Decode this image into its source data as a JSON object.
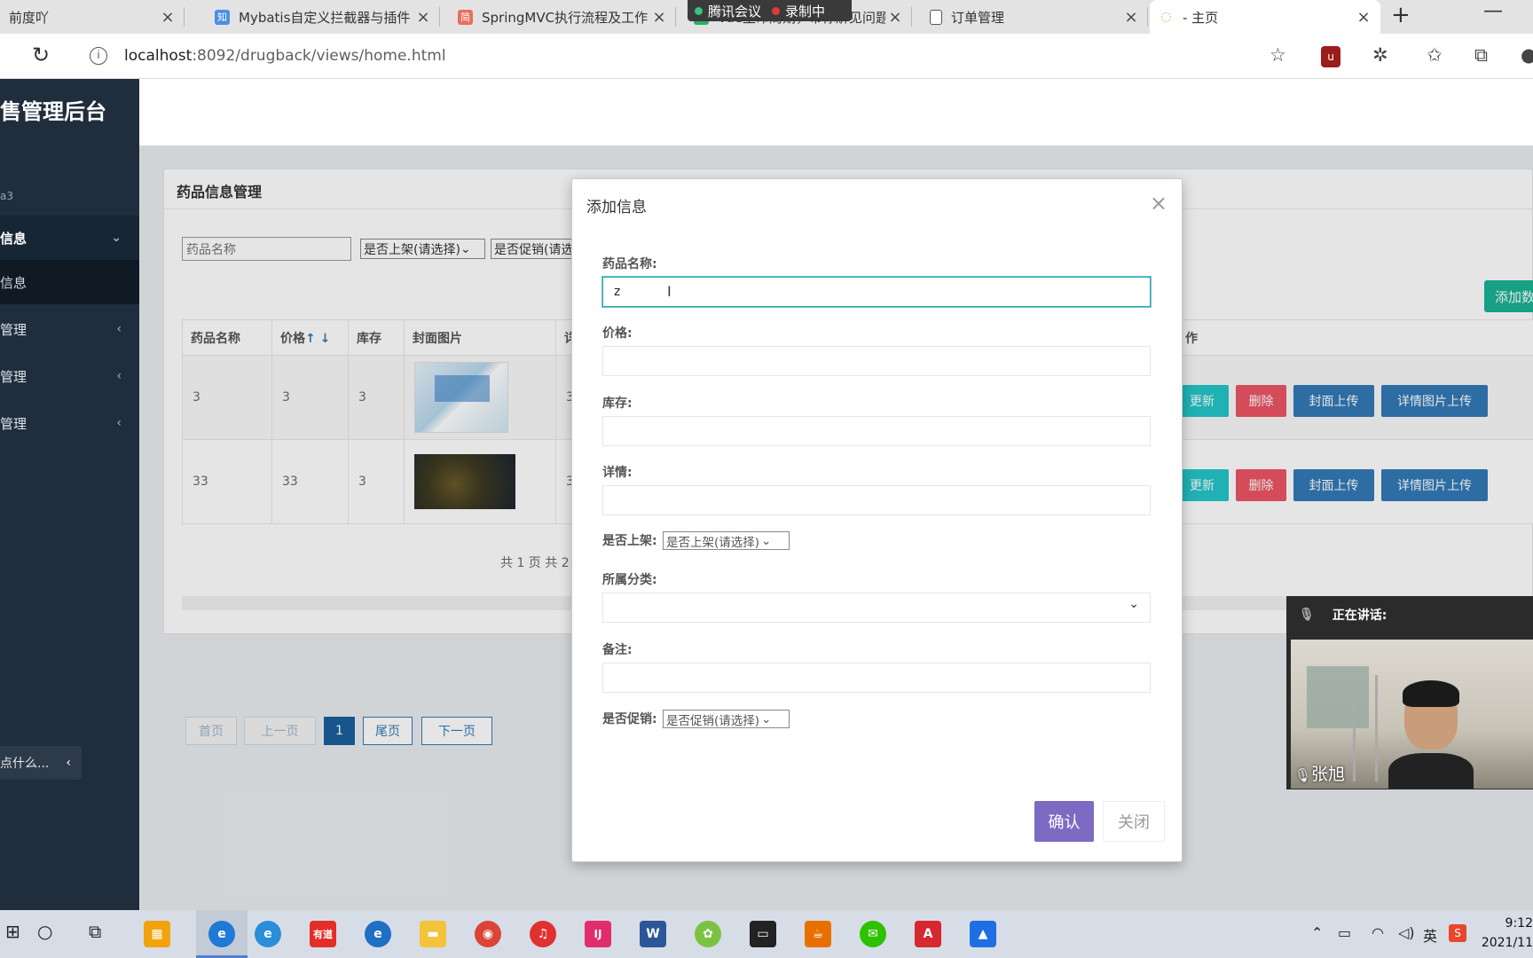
{
  "browser": {
    "tabs": [
      {
        "title": "前度吖",
        "icon": "avatar-icon",
        "color": "#999999"
      },
      {
        "title": "Mybatis自定义拦截器与插件",
        "icon": "zhihu-icon",
        "color": "#4a90e2"
      },
      {
        "title": "SpringMVC执行流程及工作",
        "icon": "jianshu-icon",
        "color": "#ea6f5a"
      },
      {
        "title": "Vue生命周期，带你解见问题",
        "icon": "wechat-icon",
        "color": "#2aae67"
      },
      {
        "title": "订单管理",
        "icon": "document-icon",
        "color": "#555555"
      },
      {
        "title": "- 主页",
        "icon": "loading-icon",
        "color": "#f2a64a"
      }
    ],
    "meeting_bar": {
      "app": "腾讯会议",
      "status": "录制中"
    },
    "url_host": "localhost",
    "url_rest": ":8092/drugback/views/home.html"
  },
  "app": {
    "brand": "售管理后台",
    "user_label": "a3",
    "menu": [
      {
        "label": "信息",
        "open": true
      },
      {
        "label": "管理",
        "open": false
      },
      {
        "label": "管理",
        "open": false
      },
      {
        "label": "管理",
        "open": false
      }
    ],
    "submenu": "信息",
    "chat_stub": "点什么..."
  },
  "panel": {
    "title": "药品信息管理",
    "search_placeholder": "药品名称",
    "filter_shelf": "是否上架(请选择)",
    "filter_promo": "是否促销(请选",
    "add_button": "添加数",
    "columns": [
      "药品名称",
      "价格",
      "库存",
      "封面图片",
      "详",
      "作"
    ],
    "sort_arrows": "↑ ↓",
    "rows": [
      {
        "name": "3",
        "price": "3",
        "stock": "3",
        "detail": "3"
      },
      {
        "name": "33",
        "price": "33",
        "stock": "3",
        "detail": "3"
      }
    ],
    "row_actions": {
      "update": "更新",
      "delete": "删除",
      "cover": "封面上传",
      "detail_img": "详情图片上传"
    },
    "pagination": {
      "first": "首页",
      "prev": "上一页",
      "current": "1",
      "last": "尾页",
      "next": "下一页",
      "total": "共 1 页 共 2"
    }
  },
  "modal": {
    "title": "添加信息",
    "close": "×",
    "fields": {
      "name_label": "药品名称:",
      "name_value": "z",
      "price_label": "价格:",
      "stock_label": "库存:",
      "detail_label": "详情:",
      "shelf_label": "是否上架:",
      "shelf_value": "是否上架(请选择)",
      "category_label": "所属分类:",
      "category_value": "",
      "remark_label": "备注:",
      "promo_label": "是否促销:",
      "promo_value": "是否促销(请选择)"
    },
    "confirm": "确认",
    "close_btn": "关闭"
  },
  "meeting_video": {
    "speaking_label": "正在讲话:",
    "speaker": "张旭"
  },
  "taskbar": {
    "apps": [
      {
        "name": "store-icon",
        "color": "#f0a30a"
      },
      {
        "name": "edge-icon",
        "color": "#1e7ad6"
      },
      {
        "name": "ie-icon",
        "color": "#2a8ed8"
      },
      {
        "name": "youdao-icon",
        "color": "#e52d27",
        "label": "有道"
      },
      {
        "name": "edge-beta-icon",
        "color": "#1f6fc4"
      },
      {
        "name": "file-explorer-icon",
        "color": "#f3c33b"
      },
      {
        "name": "chrome-icon",
        "color": "#db4437"
      },
      {
        "name": "netease-music-icon",
        "color": "#e03030"
      },
      {
        "name": "intellij-icon",
        "color": "#e22d6d",
        "label": "IJ"
      },
      {
        "name": "word-icon",
        "color": "#2b579a",
        "label": "W"
      },
      {
        "name": "app-green-icon",
        "color": "#7cc242"
      },
      {
        "name": "terminal-icon",
        "color": "#222222"
      },
      {
        "name": "java-icon",
        "color": "#e76f00"
      },
      {
        "name": "wechat-icon",
        "color": "#2dc100"
      },
      {
        "name": "acrobat-icon",
        "color": "#d7282f"
      },
      {
        "name": "feishu-icon",
        "color": "#1f6fe4"
      }
    ],
    "ime": "英",
    "time": "9:12",
    "date": "2021/11"
  },
  "colors": {
    "sidebar": "#1f2d3d",
    "primary": "#337ab7",
    "danger": "#ed5565",
    "info": "#23c6c8",
    "confirm": "#7c6ac3",
    "success": "#1ab394"
  }
}
